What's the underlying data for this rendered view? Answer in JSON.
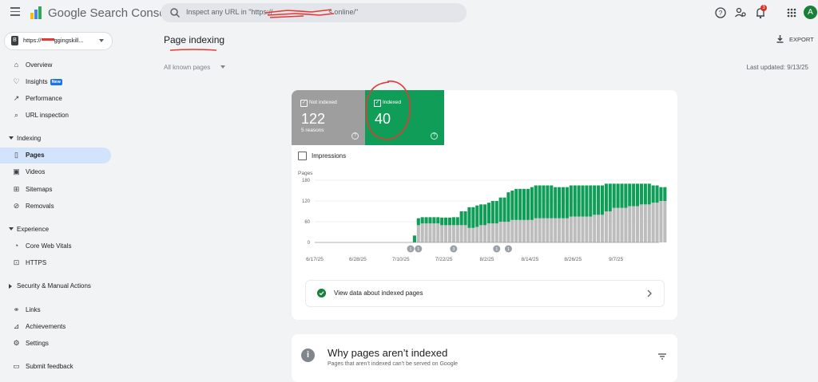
{
  "app": {
    "title": "Google Search Console"
  },
  "search": {
    "placeholder": "Inspect any URL in \"https://",
    "placeholder_tail": "s.online/\""
  },
  "topbar": {
    "notification_count": "3",
    "avatar_letter": "A",
    "icons": [
      "help-icon",
      "manage-users-icon",
      "bell-icon",
      "apps-icon"
    ]
  },
  "property": {
    "label": "https://",
    "label_tail": "ggingskill...",
    "icon_letter": "B"
  },
  "sidebar": {
    "items_top": [
      {
        "label": "Overview",
        "icon": "home-icon"
      },
      {
        "label": "Insights",
        "icon": "lightbulb-icon",
        "badge": "New"
      },
      {
        "label": "Performance",
        "icon": "trending-icon"
      },
      {
        "label": "URL inspection",
        "icon": "search-icon"
      }
    ],
    "indexing_section": "Indexing",
    "indexing_items": [
      {
        "label": "Pages",
        "icon": "pages-icon",
        "active": true
      },
      {
        "label": "Videos",
        "icon": "videos-icon"
      },
      {
        "label": "Sitemaps",
        "icon": "sitemap-icon"
      },
      {
        "label": "Removals",
        "icon": "removals-icon"
      }
    ],
    "experience_section": "Experience",
    "experience_items": [
      {
        "label": "Core Web Vitals",
        "icon": "speed-icon"
      },
      {
        "label": "HTTPS",
        "icon": "lock-icon"
      }
    ],
    "security_section": "Security & Manual Actions",
    "bottom_items": [
      {
        "label": "Links",
        "icon": "links-icon"
      },
      {
        "label": "Achievements",
        "icon": "achievements-icon"
      },
      {
        "label": "Settings",
        "icon": "gear-icon"
      },
      {
        "label": "Submit feedback",
        "icon": "feedback-icon"
      }
    ]
  },
  "main": {
    "page_title": "Page indexing",
    "export_label": "EXPORT",
    "filter_label": "All known pages",
    "last_updated": "Last updated: 9/13/25",
    "tiles": {
      "not_indexed": {
        "label": "Not indexed",
        "value": "122",
        "sub": "5 reasons"
      },
      "indexed": {
        "label": "Indexed",
        "value": "40"
      }
    },
    "impressions_label": "Impressions",
    "view_data_label": "View data about indexed pages",
    "why_title": "Why pages aren’t indexed",
    "why_subtitle": "Pages that aren’t indexed can’t be served on Google"
  },
  "chart_data": {
    "type": "bar",
    "stacked": true,
    "ylabel": "Pages",
    "ylim": [
      0,
      180
    ],
    "yticks": [
      "0",
      "60",
      "120",
      "180"
    ],
    "grid": true,
    "colors": {
      "not_indexed": "#bdbdbd",
      "indexed": "#0f9d58"
    },
    "xtick_labels": [
      "6/17/25",
      "6/28/25",
      "7/10/25",
      "7/22/25",
      "8/2/25",
      "8/14/25",
      "8/26/25",
      "9/7/25"
    ],
    "annotations": [
      {
        "day": 24,
        "label": "1"
      },
      {
        "day": 26,
        "label": "1"
      },
      {
        "day": 35,
        "label": "3"
      },
      {
        "day": 46,
        "label": "1"
      },
      {
        "day": 49,
        "label": "1"
      }
    ],
    "days": 88,
    "start_day": 25,
    "series": [
      {
        "name": "Not indexed",
        "values": [
          0,
          50,
          55,
          55,
          55,
          55,
          55,
          50,
          50,
          50,
          50,
          50,
          50,
          50,
          42,
          42,
          45,
          50,
          50,
          55,
          55,
          55,
          60,
          60,
          60,
          65,
          65,
          65,
          65,
          65,
          65,
          70,
          70,
          70,
          70,
          70,
          70,
          70,
          70,
          70,
          75,
          75,
          75,
          75,
          75,
          75,
          80,
          80,
          80,
          90,
          90,
          100,
          100,
          100,
          100,
          105,
          105,
          105,
          110,
          110,
          110,
          115,
          115,
          120,
          120
        ]
      },
      {
        "name": "Indexed",
        "values": [
          20,
          20,
          18,
          18,
          18,
          18,
          18,
          22,
          22,
          22,
          23,
          23,
          40,
          40,
          60,
          60,
          62,
          60,
          60,
          60,
          65,
          65,
          70,
          70,
          85,
          85,
          90,
          90,
          90,
          90,
          95,
          95,
          95,
          95,
          95,
          95,
          90,
          90,
          90,
          90,
          90,
          90,
          90,
          90,
          90,
          90,
          85,
          85,
          85,
          80,
          80,
          70,
          70,
          70,
          70,
          65,
          65,
          65,
          60,
          60,
          60,
          50,
          50,
          40,
          40
        ]
      }
    ]
  }
}
